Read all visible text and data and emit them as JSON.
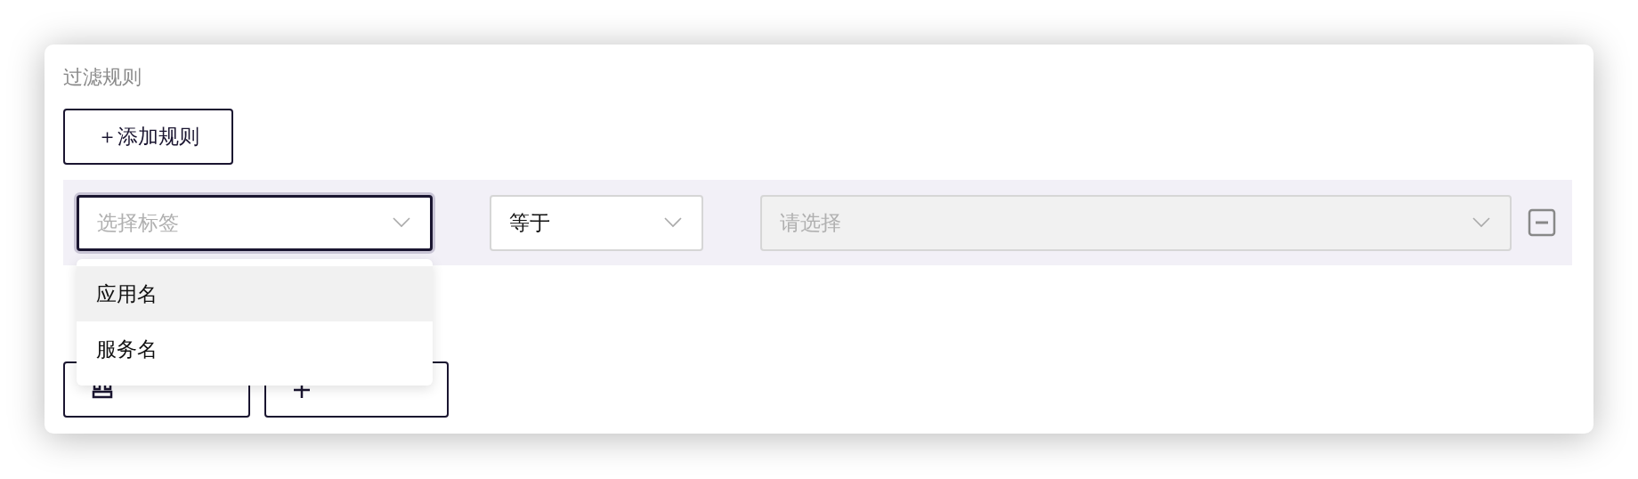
{
  "section_title": "过滤规则",
  "add_button": "＋添加规则",
  "rule": {
    "tag_select": {
      "placeholder": "选择标签",
      "focused": true
    },
    "operator_select": {
      "value": "等于",
      "disabled": false
    },
    "value_select": {
      "placeholder": "请选择",
      "disabled": true
    }
  },
  "dropdown": {
    "options": [
      {
        "label": "应用名",
        "selected": true
      },
      {
        "label": "服务名",
        "selected": false
      }
    ]
  },
  "section_2": {
    "buttons": [
      {
        "kind": "template"
      },
      {
        "kind": "add"
      }
    ]
  }
}
